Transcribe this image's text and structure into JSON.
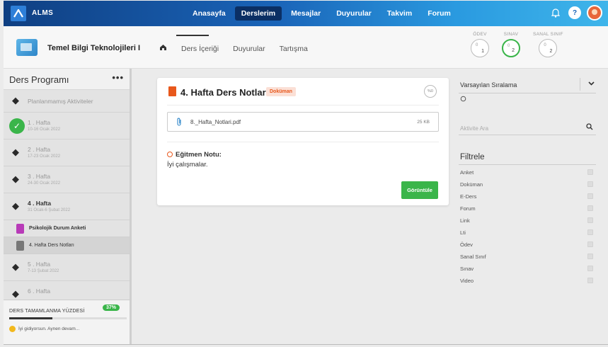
{
  "topbar": {
    "logo_text": "ALMS",
    "nav": [
      "Anasayfa",
      "Derslerim",
      "Mesajlar",
      "Duyurular",
      "Takvim",
      "Forum"
    ],
    "active_nav": "Derslerim",
    "help_label": "?"
  },
  "course": {
    "title": "Temel Bilgi Teknolojileri I",
    "tabs": {
      "content": "Ders İçeriği",
      "announcements": "Duyurular",
      "discussion": "Tartışma"
    },
    "stats": [
      {
        "label": "ÖDEV",
        "a": "0",
        "b": "1"
      },
      {
        "label": "SINAV",
        "a": "0",
        "b": "2"
      },
      {
        "label": "SANAL SINIF",
        "a": "0",
        "b": "2"
      }
    ]
  },
  "sidebar": {
    "title": "Ders Programı",
    "menu": "•••",
    "unplanned": "Planlanmamış Aktiviteler",
    "weeks": [
      {
        "name": "1 . Hafta",
        "dates": "10-16 Ocak 2022",
        "done": true
      },
      {
        "name": "2 . Hafta",
        "dates": "17-23 Ocak 2022"
      },
      {
        "name": "3 . Hafta",
        "dates": "24-30 Ocak 2022"
      },
      {
        "name": "4 . Hafta",
        "dates": "31 Ocak-6 Şubat 2022"
      },
      {
        "name": "5 . Hafta",
        "dates": "7-13 Şubat 2022"
      },
      {
        "name": "6 . Hafta",
        "dates": ""
      }
    ],
    "week4_items": [
      "Psikolojik Durum Anketi",
      "4. Hafta Ders Notları"
    ],
    "footer": {
      "label": "DERS TAMAMLANMA YÜZDESİ",
      "percent": "37%",
      "progress_fraction": 0.37,
      "message": "İyi gidiyorsun. Aynen devam..."
    }
  },
  "card": {
    "title": "4. Hafta Ders Notları",
    "badge": "Doküman",
    "time": "%0",
    "file_name": "8._Hafta_Notlari.pdf",
    "file_size": "25 KB",
    "note_title": "Eğitmen Notu:",
    "note_body": "İyi çalışmalar.",
    "button": "Görüntüle"
  },
  "right": {
    "sort": "Varsayılan Sıralama",
    "search_placeholder": "Aktivite Ara",
    "filter_title": "Filtrele",
    "filters": [
      "Anket",
      "Doküman",
      "E-Ders",
      "Forum",
      "Link",
      "Lti",
      "Ödev",
      "Sanal Sınıf",
      "Sınav",
      "Video"
    ]
  },
  "colors": {
    "accent_green": "#3ab54a",
    "doc_orange": "#e8581c",
    "nav_dark": "#0b2f64"
  }
}
